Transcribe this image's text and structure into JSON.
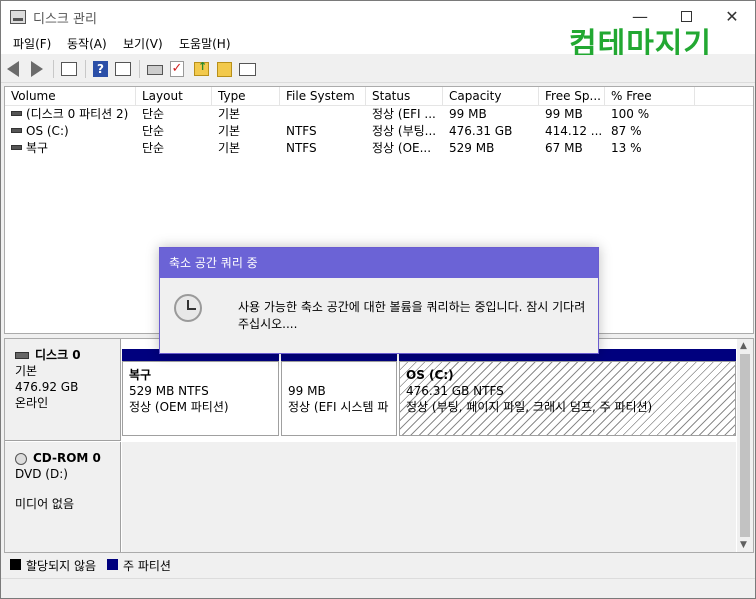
{
  "window": {
    "title": "디스크 관리",
    "minimize_glyph": "—",
    "close_glyph": "✕"
  },
  "logo": {
    "text": "컴테마지기",
    "color": "#22a832"
  },
  "menu": [
    "파일(F)",
    "동작(A)",
    "보기(V)",
    "도움말(H)"
  ],
  "toolbar": {
    "icons": [
      "back-icon",
      "forward-icon",
      "show-hide-console-icon",
      "help-icon",
      "help-topics-icon",
      "connect-icon",
      "check-icon",
      "folder-up-icon",
      "search-icon",
      "properties-icon"
    ]
  },
  "volume_list": {
    "columns": [
      "Volume",
      "Layout",
      "Type",
      "File System",
      "Status",
      "Capacity",
      "Free Sp...",
      "% Free"
    ],
    "rows": [
      [
        "(디스크 0 파티션 2)",
        "단순",
        "기본",
        "",
        "정상 (EFI ...",
        "99 MB",
        "99 MB",
        "100 %"
      ],
      [
        "OS (C:)",
        "단순",
        "기본",
        "NTFS",
        "정상 (부팅...",
        "476.31 GB",
        "414.12 ...",
        "87 %"
      ],
      [
        "복구",
        "단순",
        "기본",
        "NTFS",
        "정상 (OE...",
        "529 MB",
        "67 MB",
        "13 %"
      ]
    ]
  },
  "disks": {
    "disk0": {
      "name": "디스크 0",
      "type": "기본",
      "size": "476.92 GB",
      "state": "온라인",
      "partitions": [
        {
          "name": "복구",
          "size": "529 MB NTFS",
          "status": "정상 (OEM 파티션)"
        },
        {
          "name": "",
          "size": "99 MB",
          "status": "정상 (EFI 시스템 파"
        },
        {
          "name": "OS  (C:)",
          "size": "476.31 GB NTFS",
          "status": "정상 (부팅, 페이지 파일, 크래시 덤프, 주 파티션)"
        }
      ]
    },
    "cdrom": {
      "name": "CD-ROM 0",
      "drive": "DVD (D:)",
      "media": "미디어 없음"
    }
  },
  "legend": [
    {
      "label": "할당되지 않음",
      "color": "#000000"
    },
    {
      "label": "주 파티션",
      "color": "#00007e"
    }
  ],
  "dialog": {
    "title": "축소 공간 쿼리 중",
    "message": "사용 가능한 축소 공간에 대한 볼륨을 쿼리하는 중입니다. 잠시 기다려 주십시오...."
  },
  "colors": {
    "accent_dialog": "#6b63d6",
    "primary_partition": "#00007e"
  }
}
